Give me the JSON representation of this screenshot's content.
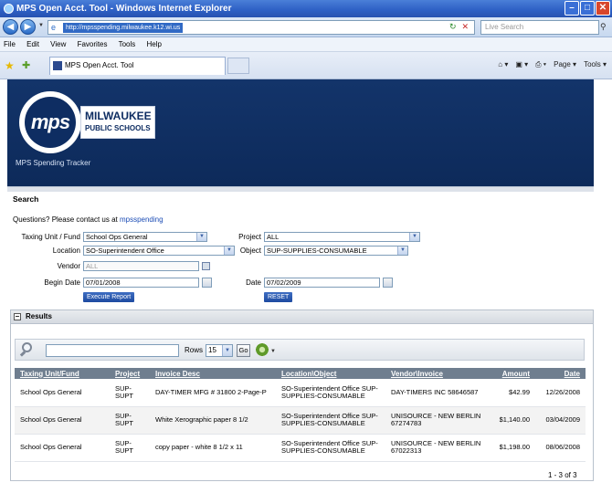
{
  "browser": {
    "title": "MPS Open Acct. Tool - Windows Internet Explorer",
    "url": "http://mpsspending.milwaukee.k12.wi.us",
    "search_placeholder": "Live Search",
    "menu": [
      "File",
      "Edit",
      "View",
      "Favorites",
      "Tools",
      "Help"
    ],
    "tab_label": "MPS Open Acct. Tool",
    "cmd_page": "Page",
    "cmd_tools": "Tools"
  },
  "header": {
    "logo_initials": "mps",
    "logo_line1": "MILWAUKEE",
    "logo_line2": "PUBLIC SCHOOLS",
    "tracker": "MPS Spending Tracker"
  },
  "search": {
    "title": "Search",
    "questions_prefix": "Questions? Please contact us at ",
    "contact_link": "mpsspending",
    "taxing_label": "Taxing Unit / Fund",
    "taxing_value": "School Ops General",
    "project_label": "Project",
    "project_value": "ALL",
    "location_label": "Location",
    "location_value": "SO-Superintendent Office",
    "object_label": "Object",
    "object_value": "SUP-SUPPLIES-CONSUMABLE",
    "vendor_label": "Vendor",
    "vendor_value": "ALL",
    "begin_label": "Begin Date",
    "begin_value": "07/01/2008",
    "date_label": "Date",
    "date_value": "07/02/2009",
    "execute_label": "Execute Report",
    "reset_label": "RESET"
  },
  "results": {
    "title": "Results",
    "rows_label": "Rows",
    "rows_value": "15",
    "go_label": "Go",
    "columns": [
      "Taxing Unit/Fund",
      "Project",
      "Invoice Desc",
      "Location\\Object",
      "Vendor\\Invoice",
      "Amount",
      "Date"
    ],
    "rows": [
      {
        "fund": "School Ops General",
        "project": "SUP-SUPT",
        "desc": "DAY-TIMER MFG # 31800 2-Page-P",
        "location": "SO-Superintendent Office SUP-SUPPLIES-CONSUMABLE",
        "vendor": "DAY-TIMERS INC 58646587",
        "amount": "$42.99",
        "date": "12/26/2008"
      },
      {
        "fund": "School Ops General",
        "project": "SUP-SUPT",
        "desc": "White Xerographic paper 8 1/2",
        "location": "SO-Superintendent Office SUP-SUPPLIES-CONSUMABLE",
        "vendor": "UNISOURCE - NEW BERLIN 67274783",
        "amount": "$1,140.00",
        "date": "03/04/2009"
      },
      {
        "fund": "School Ops General",
        "project": "SUP-SUPT",
        "desc": "copy paper - white 8 1/2 x 11",
        "location": "SO-Superintendent Office SUP-SUPPLIES-CONSUMABLE",
        "vendor": "UNISOURCE - NEW BERLIN 67022313",
        "amount": "$1,198.00",
        "date": "08/06/2008"
      }
    ],
    "pager": "1 - 3 of 3"
  }
}
